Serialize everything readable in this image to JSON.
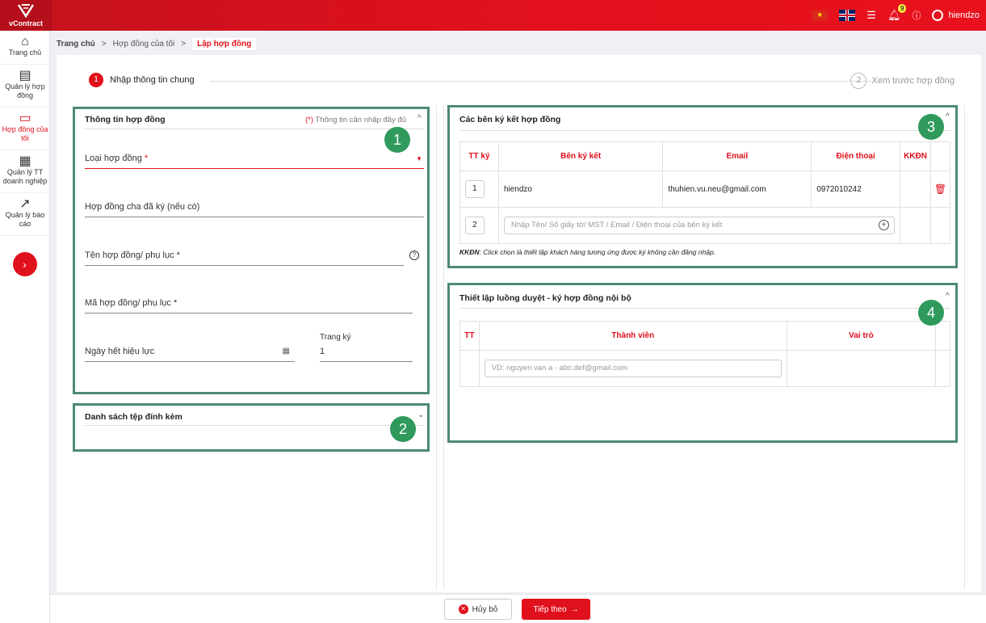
{
  "app": {
    "name": "vContract"
  },
  "topbar": {
    "badge_count": "9",
    "username": "hiendzo"
  },
  "sidebar": {
    "items": [
      {
        "label": "Trang chủ",
        "icon": "home-icon"
      },
      {
        "label": "Quản lý hợp đồng",
        "icon": "document-icon"
      },
      {
        "label": "Hợp đồng của tôi",
        "icon": "folder-icon",
        "active": true
      },
      {
        "label": "Quản lý TT doanh nghiệp",
        "icon": "building-icon"
      },
      {
        "label": "Quản lý báo cáo",
        "icon": "chart-icon"
      }
    ]
  },
  "breadcrumb": {
    "home": "Trang chủ",
    "sep": ">",
    "mine": "Hợp đồng của tôi",
    "current": "Lập hợp đồng"
  },
  "stepper": {
    "step1": {
      "num": "1",
      "label": "Nhập thông tin chung"
    },
    "step2": {
      "num": "2",
      "label": "Xem trước hợp đồng"
    }
  },
  "contract_info": {
    "title": "Thông tin hợp đồng",
    "required_note": "(*) Thông tin cần nhập đầy đủ",
    "required_mark": "(*)",
    "required_text": " Thông tin cần nhập đầy đủ",
    "type_label": "Loại hợp đồng",
    "parent_label": "Hợp đồng cha đã ký (nếu có)",
    "name_label": "Tên hợp đồng/ phụ lục *",
    "code_label": "Mã hợp đồng/ phụ lục *",
    "expiry_label": "Ngày hết hiệu lực",
    "page_label": "Trang ký",
    "page_value": "1"
  },
  "attachments": {
    "title": "Danh sách tệp đính kèm"
  },
  "signers": {
    "title": "Các bên ký kết hợp đồng",
    "columns": [
      "TT ký",
      "Bên ký kết",
      "Email",
      "Điện thoại",
      "KKĐN"
    ],
    "rows": [
      {
        "order": "1",
        "party": "hiendzo",
        "email": "thuhien.vu.neu@gmail.com",
        "phone": "0972010242"
      }
    ],
    "new_row": {
      "order": "2",
      "placeholder": "Nhập Tên/ Số giấy tờ/ MST / Email / Điện thoại của bên ký kết"
    },
    "note_bold": "KKĐN",
    "note_text": ": Click chọn là thiết lập khách hàng tương ứng được ký không cần đăng nhập."
  },
  "approval_flow": {
    "title": "Thiết lập luồng duyệt - ký hợp đồng nội bộ",
    "columns": [
      "TT",
      "Thành viên",
      "Vai trò"
    ],
    "member_placeholder": "VD: nguyen van a - abc.def@gmail.com"
  },
  "annotations": [
    "1",
    "2",
    "3",
    "4"
  ],
  "footer": {
    "cancel_label": "Hủy bỏ",
    "next_label": "Tiếp theo"
  },
  "colors": {
    "brand": "#e0101c",
    "annotation_border": "#4e8a74",
    "annotation_fill": "#2f9a5c"
  }
}
